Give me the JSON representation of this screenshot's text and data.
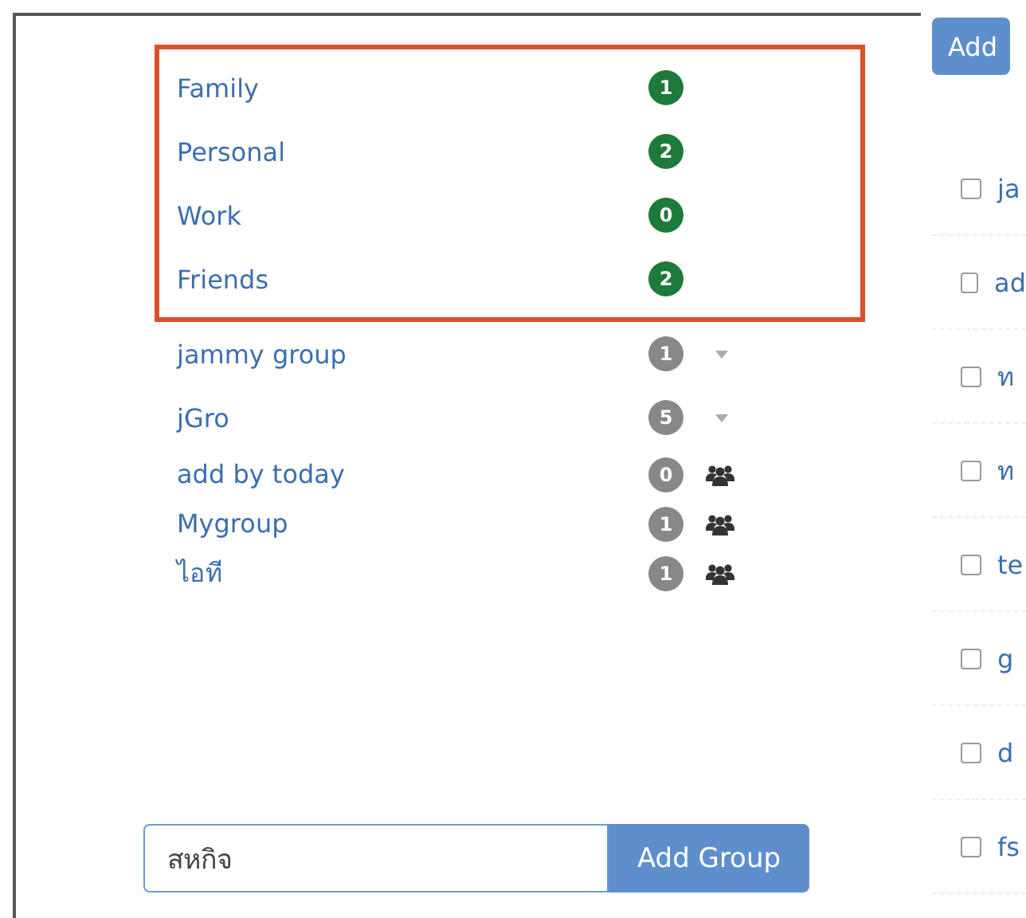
{
  "group_sections": [
    {
      "highlighted": true,
      "items": [
        {
          "name": "Family",
          "count": "1",
          "kind": "default"
        },
        {
          "name": "Personal",
          "count": "2",
          "kind": "default"
        },
        {
          "name": "Work",
          "count": "0",
          "kind": "default"
        },
        {
          "name": "Friends",
          "count": "2",
          "kind": "default"
        }
      ]
    },
    {
      "highlighted": false,
      "items": [
        {
          "name": "jammy group",
          "count": "1",
          "kind": "dropdown"
        },
        {
          "name": "jGro",
          "count": "5",
          "kind": "dropdown"
        },
        {
          "name": "add by today",
          "count": "0",
          "kind": "shared"
        },
        {
          "name": "Mygroup",
          "count": "1",
          "kind": "shared"
        },
        {
          "name": "ไอที",
          "count": "1",
          "kind": "shared"
        }
      ]
    }
  ],
  "new_group": {
    "value": "สหกิจ",
    "button": "Add Group"
  },
  "right_panel": {
    "button": "Add",
    "items": [
      {
        "label": "ja",
        "checked": false
      },
      {
        "label": "ad",
        "checked": false
      },
      {
        "label": "ท",
        "checked": false
      },
      {
        "label": "ท",
        "checked": false
      },
      {
        "label": "te",
        "checked": false
      },
      {
        "label": "g",
        "checked": false
      },
      {
        "label": "d",
        "checked": false
      },
      {
        "label": "fs",
        "checked": false
      }
    ]
  }
}
